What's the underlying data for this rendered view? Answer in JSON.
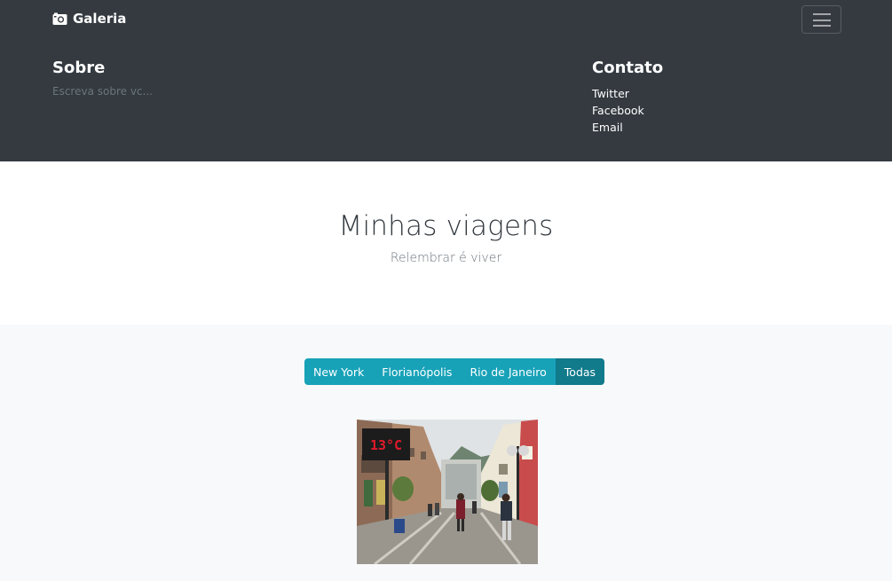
{
  "navbar": {
    "brand": "Galeria",
    "brand_icon": "camera-icon",
    "toggler_icon": "hamburger-icon"
  },
  "about": {
    "title": "Sobre",
    "text": "Escreva sobre vc..."
  },
  "contact": {
    "title": "Contato",
    "links": [
      "Twitter",
      "Facebook",
      "Email"
    ]
  },
  "hero": {
    "title": "Minhas viagens",
    "subtitle": "Relembrar é viver"
  },
  "filters": {
    "buttons": [
      "New York",
      "Florianópolis",
      "Rio de Janeiro",
      "Todas"
    ],
    "active": "Todas"
  },
  "photo": {
    "sign_text": "13°C"
  },
  "colors": {
    "header_bg": "#343a40",
    "filter_bg": "#17a2b8",
    "filter_active_bg": "#117a8b",
    "page_bg": "#f8f9fa"
  }
}
